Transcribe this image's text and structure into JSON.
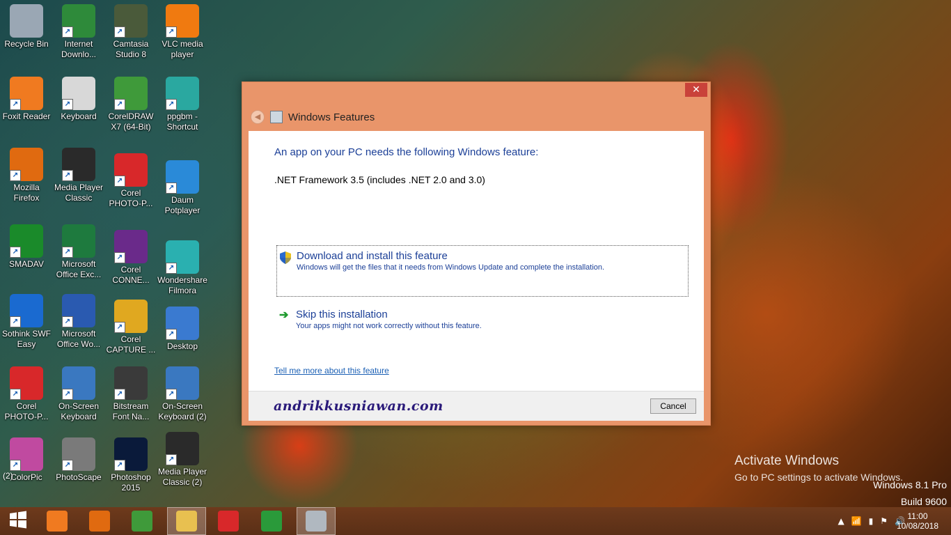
{
  "desktop_icons": [
    {
      "label": "Recycle Bin",
      "icon": "recycle-bin-icon",
      "color": "#9aa7b4"
    },
    {
      "label": "Internet Downlo...",
      "icon": "internet-download-manager-icon",
      "color": "#2e8a3a"
    },
    {
      "label": "Camtasia Studio 8",
      "icon": "camtasia-icon",
      "color": "#4a5a3a"
    },
    {
      "label": "VLC media player",
      "icon": "vlc-icon",
      "color": "#f07a10"
    },
    {
      "label": "Foxit Reader",
      "icon": "foxit-reader-icon",
      "color": "#f07a20"
    },
    {
      "label": "Keyboard",
      "icon": "keyboard-icon",
      "color": "#d8d8d8"
    },
    {
      "label": "CorelDRAW X7 (64-Bit)",
      "icon": "coreldraw-icon",
      "color": "#3f9a3a"
    },
    {
      "label": "ppgbm - Shortcut",
      "icon": "ppgbm-icon",
      "color": "#2aa8a0"
    },
    {
      "label": "Mozilla Firefox",
      "icon": "firefox-icon",
      "color": "#e06a10"
    },
    {
      "label": "Media Player Classic",
      "icon": "media-player-classic-icon",
      "color": "#2a2a2a"
    },
    {
      "label": "Corel PHOTO-P...",
      "icon": "corel-photo-paint-icon",
      "color": "#d8282a"
    },
    {
      "label": "Daum Potplayer",
      "icon": "potplayer-icon",
      "color": "#2a8ad8"
    },
    {
      "label": "SMADAV",
      "icon": "smadav-icon",
      "color": "#1a8a2a"
    },
    {
      "label": "Microsoft Office Exc...",
      "icon": "excel-icon",
      "color": "#1e7a3e"
    },
    {
      "label": "Corel CONNE...",
      "icon": "corel-connect-icon",
      "color": "#6a2a8a"
    },
    {
      "label": "Wondershare Filmora",
      "icon": "filmora-icon",
      "color": "#2ab0b0"
    },
    {
      "label": "Sothink SWF Easy",
      "icon": "sothink-icon",
      "color": "#1a6ad0"
    },
    {
      "label": "Microsoft Office Wo...",
      "icon": "word-icon",
      "color": "#2a5ab0"
    },
    {
      "label": "Corel CAPTURE ...",
      "icon": "corel-capture-icon",
      "color": "#e0a820"
    },
    {
      "label": "Desktop",
      "icon": "desktop-icon",
      "color": "#3a7ad0"
    },
    {
      "label": "Corel PHOTO-P...",
      "icon": "corel-photo-paint-icon",
      "color": "#d8282a"
    },
    {
      "label": "On-Screen Keyboard",
      "icon": "on-screen-keyboard-icon",
      "color": "#3a78c0"
    },
    {
      "label": "Bitstream Font Na...",
      "icon": "bitstream-icon",
      "color": "#3a3a3a"
    },
    {
      "label": "On-Screen Keyboard (2)",
      "icon": "on-screen-keyboard-icon",
      "color": "#3a78c0"
    },
    {
      "label": "ColorPic",
      "icon": "colorpic-icon",
      "color": "#c04aa0"
    },
    {
      "label": "PhotoScape",
      "icon": "photoscape-icon",
      "color": "#7a7a7a"
    },
    {
      "label": "Photoshop 2015",
      "icon": "photoshop-icon",
      "color": "#0a1a3a"
    },
    {
      "label": "Media Player Classic (2)",
      "icon": "media-player-classic-icon",
      "color": "#2a2a2a"
    }
  ],
  "stray_label": "(2)",
  "dialog": {
    "title": "Windows Features",
    "close_label": "✕",
    "heading": "An app on your PC needs the following Windows feature:",
    "feature_name": ".NET Framework 3.5 (includes .NET 2.0 and 3.0)",
    "option_download": {
      "title": "Download and install this feature",
      "desc": "Windows will get the files that it needs from Windows Update and complete the installation."
    },
    "option_skip": {
      "title": "Skip this installation",
      "desc": "Your apps might not work correctly without this feature."
    },
    "link": "Tell me more about this feature",
    "watermark": "andrikkusniawan.com",
    "cancel": "Cancel"
  },
  "activation": {
    "line1": "Activate Windows",
    "line2": "Go to PC settings to activate Windows."
  },
  "build": {
    "line1": "Windows 8.1 Pro",
    "line2": "Build 9600"
  },
  "taskbar": {
    "items": [
      {
        "name": "start-button",
        "icon": "windows-logo-icon",
        "color": "#ffffff"
      },
      {
        "name": "taskbar-foxit",
        "icon": "foxit-reader-icon",
        "color": "#f07a20"
      },
      {
        "name": "taskbar-firefox",
        "icon": "firefox-icon",
        "color": "#e06a10"
      },
      {
        "name": "taskbar-coreldraw",
        "icon": "coreldraw-icon",
        "color": "#3f9a3a"
      },
      {
        "name": "taskbar-file-explorer",
        "icon": "folder-icon",
        "color": "#e8c050"
      },
      {
        "name": "taskbar-corel-photo-paint",
        "icon": "corel-photo-paint-icon",
        "color": "#d8282a"
      },
      {
        "name": "taskbar-store",
        "icon": "store-icon",
        "color": "#2a9a3a"
      },
      {
        "name": "taskbar-windows-features",
        "icon": "windows-features-icon",
        "color": "#b0b8c0"
      }
    ],
    "tray_icons": [
      "show-hidden-icons-icon",
      "network-icon",
      "battery-icon",
      "action-center-flag-icon",
      "volume-icon"
    ],
    "time": "11:00",
    "date": "10/08/2018"
  }
}
